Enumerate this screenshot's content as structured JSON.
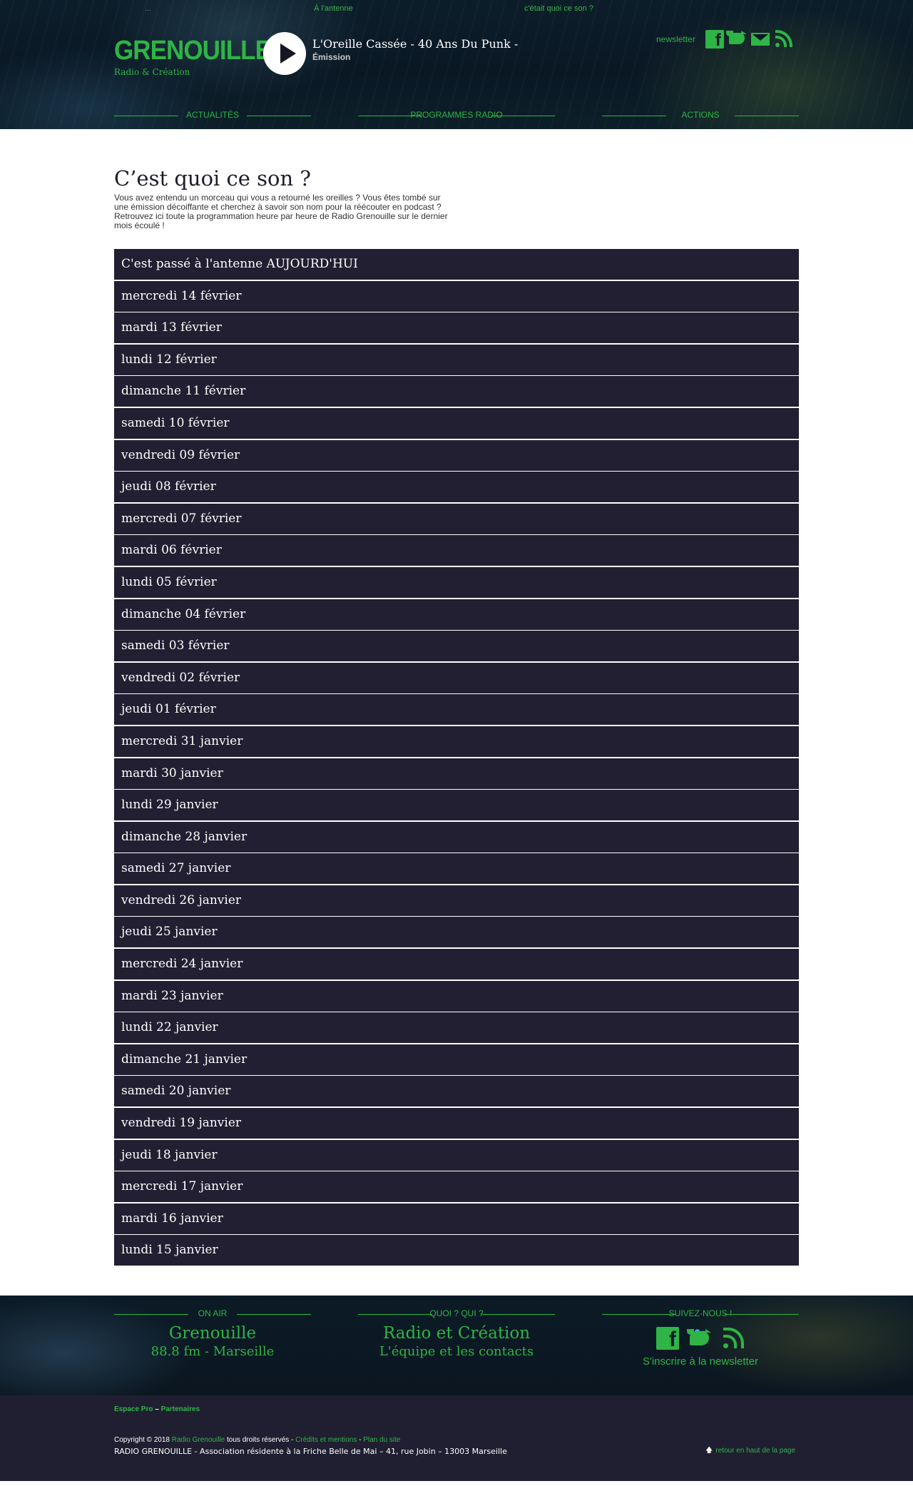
{
  "header": {
    "top_dots": "...",
    "top_link_antenne": "À l'antenne",
    "top_link_son": "c'était quoi ce son ?",
    "logo_name": "GRENOUILLE",
    "logo_tagline": "Radio & Création",
    "now_playing_title": "L'Oreille Cassée - 40 Ans Du Punk -",
    "now_playing_type": "Émission",
    "newsletter_label": "newsletter",
    "nav": [
      "ACTUALITÉS",
      "PROGRAMMES RADIO",
      "ACTIONS"
    ]
  },
  "main": {
    "title": "C’est quoi ce son ?",
    "intro": "Vous avez entendu un morceau qui vous a retourné les oreilles ? Vous êtes tombé sur une émission décoiffante et cherchez à savoir son nom pour la réécouter en podcast ? Retrouvez ici toute la programmation heure par heure de Radio Grenouille sur le dernier mois écoulé !",
    "days": [
      "C'est passé à l'antenne AUJOURD'HUI",
      "mercredi 14 février",
      "mardi 13 février",
      "lundi 12 février",
      "dimanche 11 février",
      "samedi 10 février",
      "vendredi 09 février",
      "jeudi 08 février",
      "mercredi 07 février",
      "mardi 06 février",
      "lundi 05 février",
      "dimanche 04 février",
      "samedi 03 février",
      "vendredi 02 février",
      "jeudi 01 février",
      "mercredi 31 janvier",
      "mardi 30 janvier",
      "lundi 29 janvier",
      "dimanche 28 janvier",
      "samedi 27 janvier",
      "vendredi 26 janvier",
      "jeudi 25 janvier",
      "mercredi 24 janvier",
      "mardi 23 janvier",
      "lundi 22 janvier",
      "dimanche 21 janvier",
      "samedi 20 janvier",
      "vendredi 19 janvier",
      "jeudi 18 janvier",
      "mercredi 17 janvier",
      "mardi 16 janvier",
      "lundi 15 janvier"
    ]
  },
  "footer": {
    "onair_head": "ON AIR",
    "onair_name": "Grenouille",
    "onair_freq": "88.8 fm - Marseille",
    "who_head": "QUOI ? QUI ?",
    "who_title": "Radio et Création",
    "who_link": "L'équipe et les contacts",
    "follow_head": "SUIVEZ-NOUS !",
    "newsletter_link": "S'inscrire à la newsletter",
    "espace_pro": "Espace Pro",
    "links_sep": " – ",
    "partenaires": "Partenaires",
    "copyright_prefix": "Copyright © 2018 ",
    "copyright_radio": "Radio Grenouille",
    "copyright_rights": " tous droits réservés - ",
    "credits": "Crédits et mentions",
    "dash": " - ",
    "plan": "Plan du site",
    "address": "RADIO GRENOUILLE - Association résidente à la Friche Belle de Mai – 41, rue Jobin – 13003 Marseille",
    "back_to_top": "retour en haut de la page"
  },
  "colors": {
    "accent_green": "#2fb446",
    "list_bg": "#211f31",
    "footer_bg": "#201f31"
  },
  "icons": [
    "play-icon",
    "facebook-icon",
    "twitter-icon",
    "mail-icon",
    "rss-icon",
    "arrow-up-icon"
  ]
}
